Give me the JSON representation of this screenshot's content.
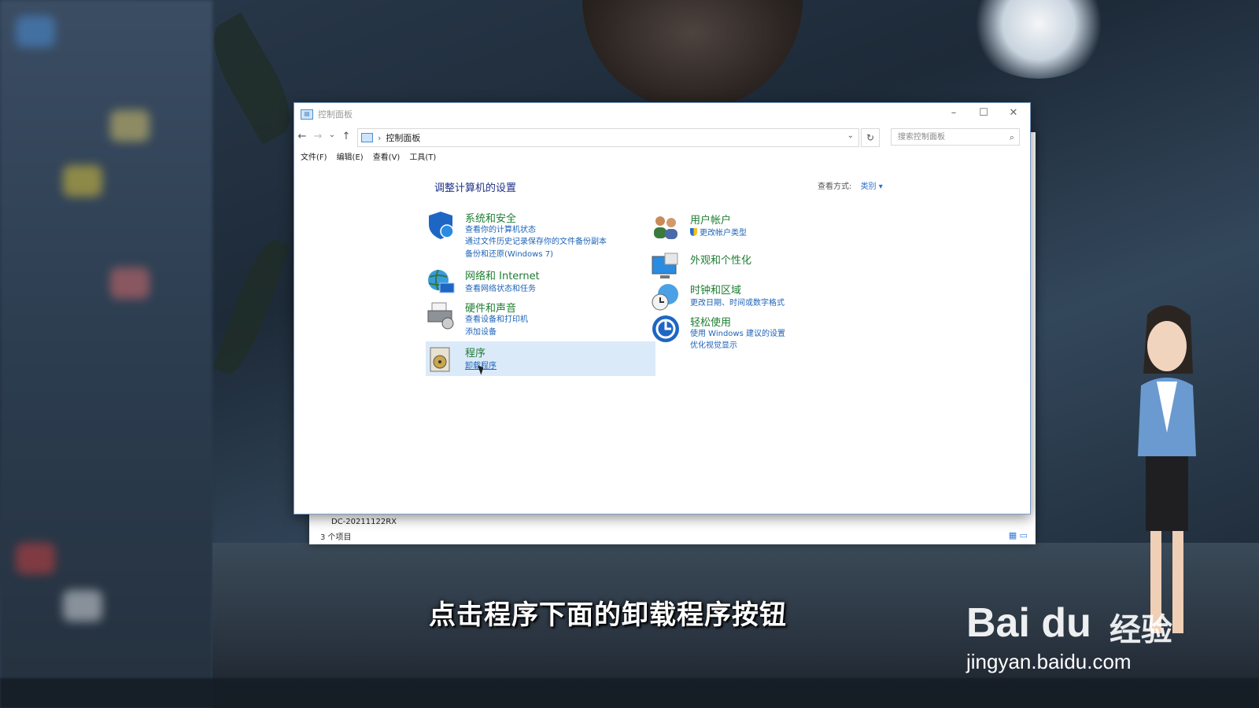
{
  "window": {
    "title": "控制面板",
    "controls": {
      "minimize": "–",
      "maximize": "☐",
      "close": "✕"
    }
  },
  "navigation": {
    "back": "←",
    "forward": "→",
    "recent": "⌄",
    "up": "↑",
    "address_sep": "›",
    "address": "控制面板",
    "refresh": "↻",
    "search_placeholder": "搜索控制面板"
  },
  "menu": [
    "文件(F)",
    "编辑(E)",
    "查看(V)",
    "工具(T)"
  ],
  "content": {
    "heading": "调整计算机的设置",
    "view_by_label": "查看方式:",
    "view_by_value": "类别 ▾",
    "left_categories": [
      {
        "title": "系统和安全",
        "links": [
          "查看你的计算机状态",
          "通过文件历史记录保存你的文件备份副本",
          "备份和还原(Windows 7)"
        ]
      },
      {
        "title": "网络和 Internet",
        "links": [
          "查看网络状态和任务"
        ]
      },
      {
        "title": "硬件和声音",
        "links": [
          "查看设备和打印机",
          "添加设备"
        ]
      },
      {
        "title": "程序",
        "links": [
          "卸载程序"
        ]
      }
    ],
    "right_categories": [
      {
        "title": "用户帐户",
        "links": [
          "更改帐户类型"
        ]
      },
      {
        "title": "外观和个性化",
        "links": []
      },
      {
        "title": "时钟和区域",
        "links": [
          "更改日期、时间或数字格式"
        ]
      },
      {
        "title": "轻松使用",
        "links": [
          "使用 Windows 建议的设置",
          "优化视觉显示"
        ]
      }
    ]
  },
  "background_window": {
    "status_items": "3 个项目",
    "pc_name": "DC-20211122RX"
  },
  "overlay": {
    "subtitle": "点击程序下面的卸载程序按钮",
    "watermark_brand": "Bai du",
    "watermark_product": "经验",
    "watermark_url": "jingyan.baidu.com"
  },
  "colors": {
    "heading": "#1e3287",
    "category_title": "#1e7d32",
    "link": "#1e63b8",
    "highlight": "#dbeaf9"
  }
}
